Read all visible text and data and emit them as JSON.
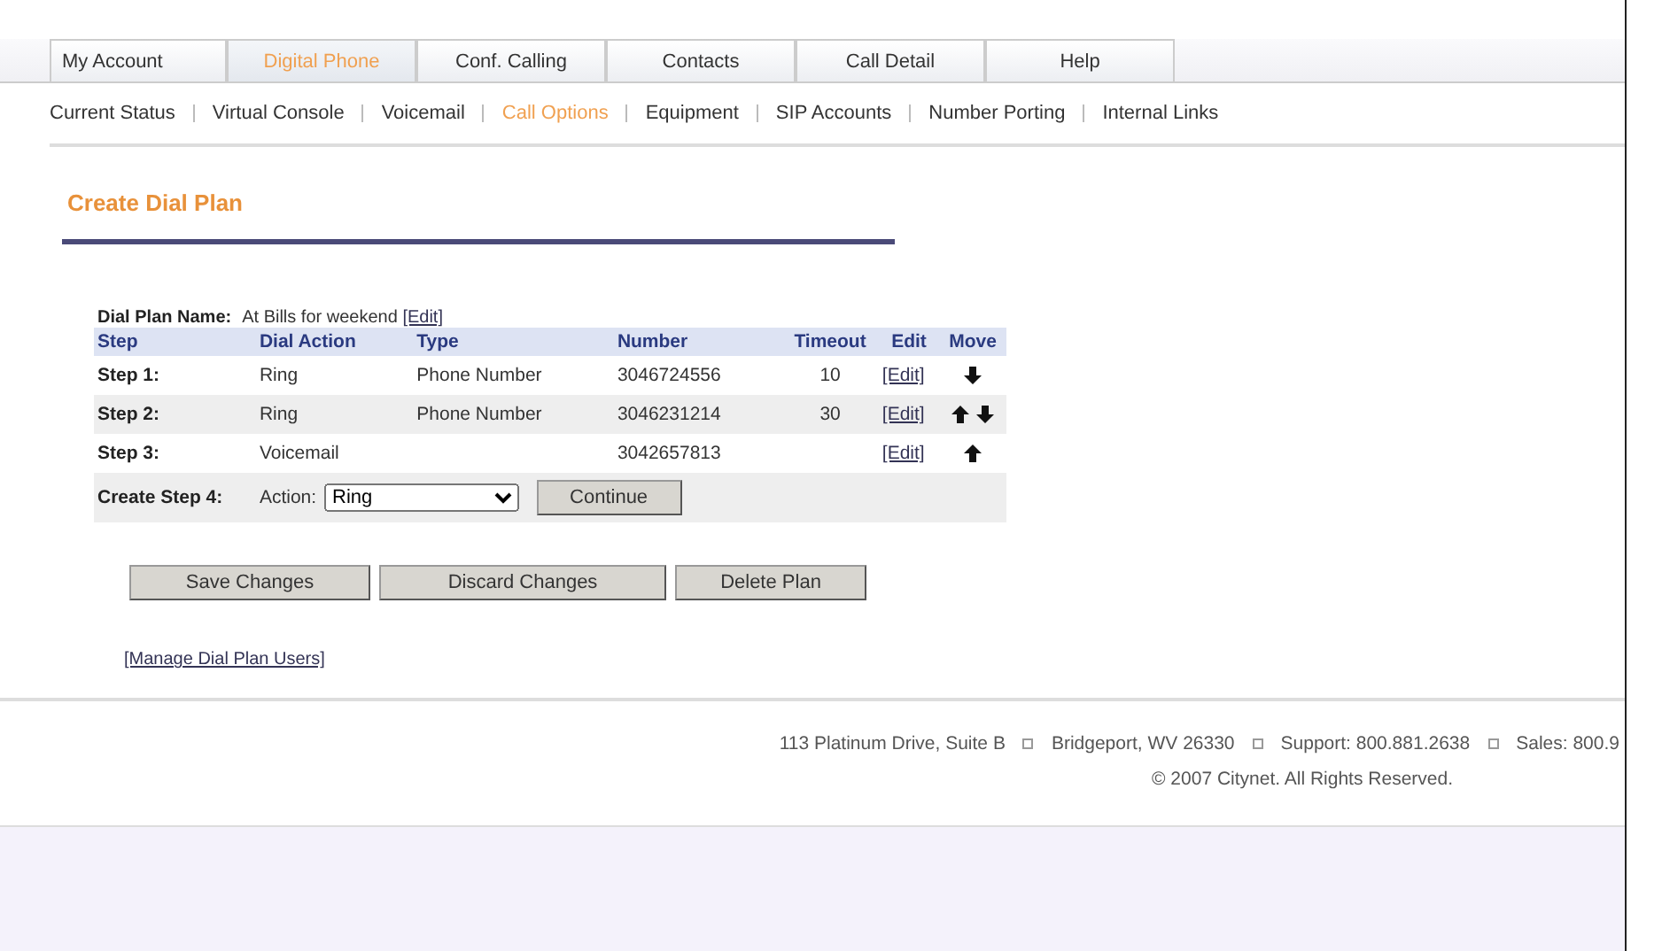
{
  "tabs": [
    {
      "label": "My Account",
      "selected": false
    },
    {
      "label": "Digital Phone",
      "selected": true
    },
    {
      "label": "Conf. Calling",
      "selected": false
    },
    {
      "label": "Contacts",
      "selected": false
    },
    {
      "label": "Call Detail",
      "selected": false
    },
    {
      "label": "Help",
      "selected": false
    }
  ],
  "subnav": [
    {
      "label": "Current Status",
      "selected": false
    },
    {
      "label": "Virtual Console",
      "selected": false
    },
    {
      "label": "Voicemail",
      "selected": false
    },
    {
      "label": "Call Options",
      "selected": true
    },
    {
      "label": "Equipment",
      "selected": false
    },
    {
      "label": "SIP Accounts",
      "selected": false
    },
    {
      "label": "Number Porting",
      "selected": false
    },
    {
      "label": "Internal Links",
      "selected": false
    }
  ],
  "page_title": "Create Dial Plan",
  "plan_name": {
    "label": "Dial Plan Name:",
    "value": "At Bills for weekend",
    "edit_link": "[Edit]"
  },
  "table": {
    "columns": [
      "Step",
      "Dial Action",
      "Type",
      "Number",
      "Timeout",
      "Edit",
      "Move"
    ],
    "rows": [
      {
        "step": "Step 1:",
        "action": "Ring",
        "type": "Phone Number",
        "number": "3046724556",
        "timeout": "10",
        "edit": "[Edit]",
        "move_up": false,
        "move_down": true
      },
      {
        "step": "Step 2:",
        "action": "Ring",
        "type": "Phone Number",
        "number": "3046231214",
        "timeout": "30",
        "edit": "[Edit]",
        "move_up": true,
        "move_down": true
      },
      {
        "step": "Step 3:",
        "action": "Voicemail",
        "number": "3042657813",
        "edit": "[Edit]",
        "move_up": true,
        "move_down": false
      }
    ],
    "create_row": {
      "label": "Create Step 4:",
      "action_label": "Action:",
      "action_value": "Ring",
      "button": "Continue"
    }
  },
  "buttons": [
    "Save Changes",
    "Discard Changes",
    "Delete Plan"
  ],
  "manage_link": "[Manage Dial Plan Users]",
  "footer": {
    "address": [
      "113 Platinum Drive, Suite B",
      "Bridgeport, WV 26330",
      "Support: 800.881.2638",
      "Sales: 800.9"
    ],
    "copyright": "© 2007 Citynet. All Rights Reserved."
  }
}
